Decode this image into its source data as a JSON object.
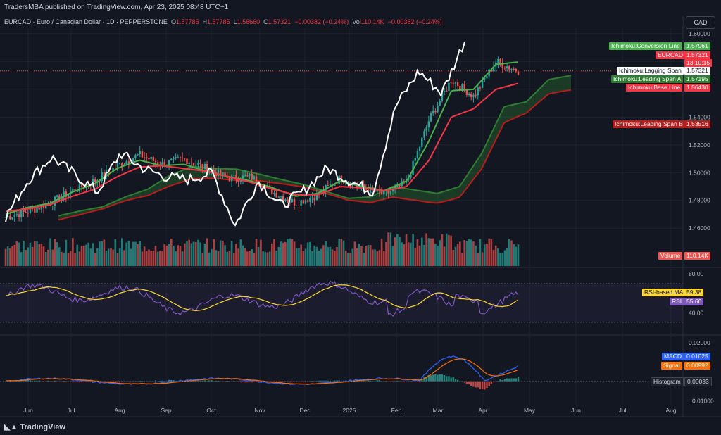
{
  "header": {
    "published": "TradersMBA published on TradingView.com, Apr 23, 2025 08:48 UTC+1",
    "symbol": "EURCAD · Euro / Canadian Dollar · 1D · PEPPERSTONE",
    "open_label": "O",
    "open": "1.57785",
    "high_label": "H",
    "high": "1.57785",
    "low_label": "L",
    "low": "1.56660",
    "close_label": "C",
    "close": "1.57321",
    "change": "−0.00382 (−0.24%)",
    "vol_label": "Vol",
    "vol": "110.14K",
    "vol_change": "−0.00382 (−0.24%)"
  },
  "currency_button": "CAD",
  "footer": {
    "brand": "TradingView"
  },
  "colors": {
    "background": "#131722",
    "grid": "#1e222d",
    "up": "#26a69a",
    "down": "#ef5350",
    "conversion": "#4caf50",
    "base": "#f23645",
    "lagging": "#ffffff",
    "span_a": "#2e7d32",
    "span_b": "#b71c1c",
    "rsi": "#7e57c2",
    "rsi_ma": "#fdd835",
    "macd": "#2962ff",
    "signal": "#ff6d00"
  },
  "chart_data": [
    {
      "type": "line",
      "name": "price",
      "description_type": "candlestick with Ichimoku Cloud and volume",
      "x_ticks": [
        "Jun",
        "Jul",
        "Aug",
        "Sep",
        "Oct",
        "Nov",
        "Dec",
        "2025",
        "Feb",
        "Mar",
        "Apr",
        "May",
        "Jun",
        "Jul",
        "Aug"
      ],
      "y_ticks": [
        "1.60000",
        "1.58000",
        "1.56000",
        "1.54000",
        "1.52000",
        "1.50000",
        "1.48000",
        "1.46000"
      ],
      "ylim": [
        1.452,
        1.604
      ],
      "x": [
        "2024-05-20",
        "2024-06-03",
        "2024-06-17",
        "2024-07-01",
        "2024-07-15",
        "2024-08-01",
        "2024-08-15",
        "2024-09-01",
        "2024-09-15",
        "2024-10-01",
        "2024-10-15",
        "2024-11-01",
        "2024-11-15",
        "2024-12-01",
        "2024-12-15",
        "2025-01-01",
        "2025-01-15",
        "2025-02-01",
        "2025-02-15",
        "2025-03-01",
        "2025-03-15",
        "2025-04-01",
        "2025-04-15",
        "2025-04-23"
      ],
      "series": [
        {
          "name": "Close",
          "values": [
            1.468,
            1.472,
            1.478,
            1.487,
            1.494,
            1.505,
            1.513,
            1.506,
            1.51,
            1.503,
            1.496,
            1.497,
            1.486,
            1.478,
            1.484,
            1.496,
            1.489,
            1.484,
            1.493,
            1.538,
            1.567,
            1.555,
            1.58,
            1.5732
          ]
        },
        {
          "name": "Ichimoku:Conversion Line",
          "values": [
            1.47,
            1.475,
            1.478,
            1.486,
            1.492,
            1.503,
            1.509,
            1.505,
            1.506,
            1.501,
            1.497,
            1.494,
            1.489,
            1.483,
            1.485,
            1.494,
            1.49,
            1.487,
            1.494,
            1.523,
            1.559,
            1.56,
            1.578,
            1.5796
          ]
        },
        {
          "name": "Ichimoku:Base Line",
          "values": [
            1.472,
            1.474,
            1.477,
            1.483,
            1.488,
            1.497,
            1.504,
            1.505,
            1.503,
            1.501,
            1.497,
            1.493,
            1.488,
            1.484,
            1.484,
            1.49,
            1.489,
            1.487,
            1.49,
            1.509,
            1.54,
            1.546,
            1.56,
            1.5643
          ]
        },
        {
          "name": "Ichimoku:Lagging Span",
          "values": [
            1.468,
            1.495,
            1.511,
            1.499,
            1.486,
            1.514,
            1.503,
            1.497,
            1.495,
            1.5,
            1.462,
            1.494,
            1.476,
            1.487,
            1.503,
            1.494,
            1.486,
            1.548,
            1.573,
            1.557,
            1.595
          ]
        }
      ]
    },
    {
      "type": "area",
      "name": "ichimoku_cloud",
      "series": [
        {
          "name": "Ichimoku:Leading Span A",
          "last": "1.57195"
        },
        {
          "name": "Ichimoku:Leading Span B",
          "last": "1.53516"
        }
      ]
    },
    {
      "type": "bar",
      "name": "volume",
      "last": "110.14K"
    },
    {
      "type": "line",
      "name": "rsi",
      "y_ticks": [
        "80.00",
        "40.00"
      ],
      "ylim": [
        20,
        85
      ],
      "series": [
        {
          "name": "RSI",
          "last": "55.66"
        },
        {
          "name": "RSI-based MA",
          "last": "59.38"
        }
      ]
    },
    {
      "type": "line",
      "name": "macd",
      "y_ticks": [
        "0.02000",
        "0.00000",
        "−0.01000"
      ],
      "ylim": [
        -0.011,
        0.021
      ],
      "series": [
        {
          "name": "MACD",
          "last": "0.01025"
        },
        {
          "name": "Signal",
          "last": "0.00992"
        },
        {
          "name": "Histogram",
          "last": "0.00033"
        }
      ]
    }
  ],
  "tags": {
    "conversion": {
      "label": "Ichimoku:Conversion Line",
      "value": "1.57961"
    },
    "price": {
      "label": "EURCAD",
      "value": "1.57321",
      "time": "13:10:15"
    },
    "lagging": {
      "label": "Ichimoku:Lagging Span",
      "value": "1.57321"
    },
    "span_a": {
      "label": "Ichimoku:Leading Span A",
      "value": "1.57195"
    },
    "base": {
      "label": "Ichimoku:Base Line",
      "value": "1.56430"
    },
    "span_b": {
      "label": "Ichimoku:Leading Span B",
      "value": "1.53516"
    },
    "volume": {
      "label": "Volume",
      "value": "110.14K"
    },
    "rsi_ma": {
      "label": "RSI-based MA",
      "value": "59.38"
    },
    "rsi": {
      "label": "RSI",
      "value": "55.66"
    },
    "macd": {
      "label": "MACD",
      "value": "0.01025"
    },
    "signal": {
      "label": "Signal",
      "value": "0.00992"
    },
    "histogram": {
      "label": "Histogram",
      "value": "0.00033"
    }
  }
}
